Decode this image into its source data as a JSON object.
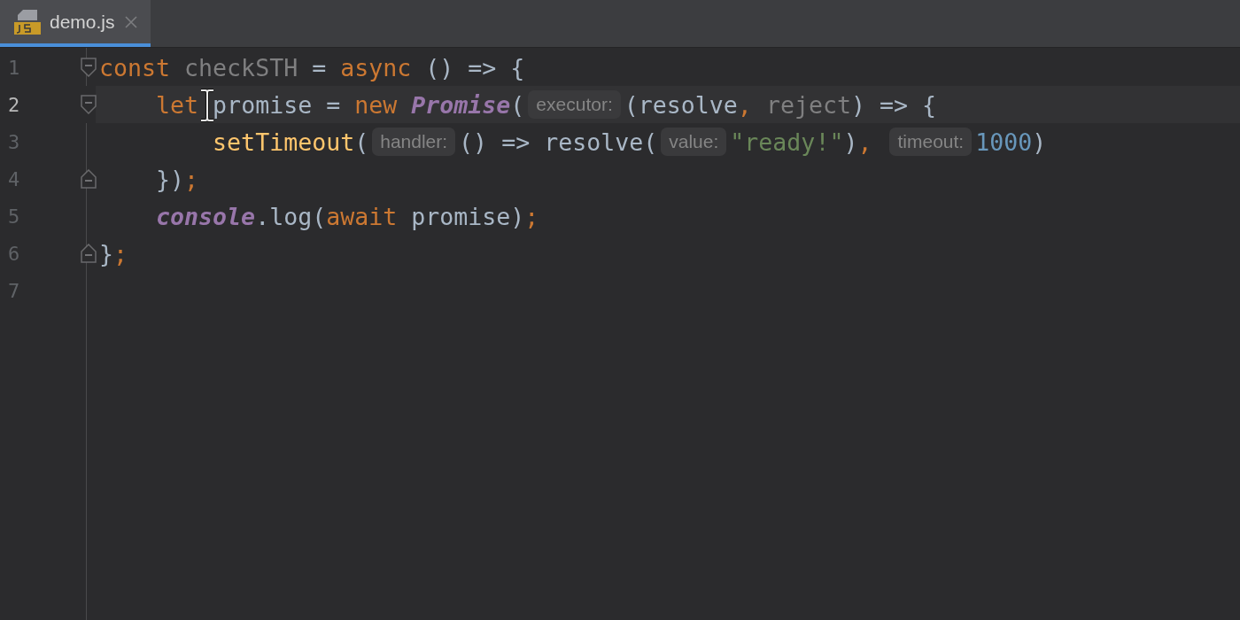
{
  "tabs": [
    {
      "label": "demo.js",
      "selected": true,
      "closable": true
    }
  ],
  "lines": [
    {
      "number": "1",
      "current": false,
      "fold_start": true,
      "fold_end": false,
      "tokens": [
        {
          "text": "const",
          "kind": "keyword"
        },
        {
          "text": " checkSTH",
          "kind": "unused"
        },
        {
          "text": " = ",
          "kind": "plain"
        },
        {
          "text": "async",
          "kind": "keyword"
        },
        {
          "text": " () => {",
          "kind": "plain"
        }
      ]
    },
    {
      "number": "2",
      "current": true,
      "fold_start": true,
      "fold_end": false,
      "tokens": [
        {
          "text": "    let",
          "kind": "keyword"
        },
        {
          "text": " promise = ",
          "kind": "plain"
        },
        {
          "text": "new ",
          "kind": "keyword"
        },
        {
          "text": "Promise",
          "kind": "class"
        },
        {
          "text": "(",
          "kind": "plain"
        },
        {
          "text": "executor:",
          "kind": "hint"
        },
        {
          "text": "(resolve",
          "kind": "plain"
        },
        {
          "text": ",",
          "kind": "comma"
        },
        {
          "text": " reject",
          "kind": "unused"
        },
        {
          "text": ") => {",
          "kind": "plain"
        }
      ]
    },
    {
      "number": "3",
      "current": false,
      "fold_start": false,
      "fold_end": false,
      "tokens": [
        {
          "text": "        setTimeout",
          "kind": "function"
        },
        {
          "text": "(",
          "kind": "plain"
        },
        {
          "text": "handler:",
          "kind": "hint"
        },
        {
          "text": "() => resolve(",
          "kind": "plain"
        },
        {
          "text": "value:",
          "kind": "hint"
        },
        {
          "text": "\"ready!\"",
          "kind": "string"
        },
        {
          "text": ")",
          "kind": "plain"
        },
        {
          "text": ", ",
          "kind": "comma"
        },
        {
          "text": "timeout:",
          "kind": "hint"
        },
        {
          "text": "1000",
          "kind": "number"
        },
        {
          "text": ")",
          "kind": "plain"
        }
      ]
    },
    {
      "number": "4",
      "current": false,
      "fold_start": false,
      "fold_end": true,
      "tokens": [
        {
          "text": "    })",
          "kind": "plain"
        },
        {
          "text": ";",
          "kind": "comma"
        }
      ]
    },
    {
      "number": "5",
      "current": false,
      "fold_start": false,
      "fold_end": false,
      "tokens": [
        {
          "text": "    console",
          "kind": "global"
        },
        {
          "text": ".log(",
          "kind": "plain"
        },
        {
          "text": "await",
          "kind": "keyword"
        },
        {
          "text": " promise)",
          "kind": "plain"
        },
        {
          "text": ";",
          "kind": "comma"
        }
      ]
    },
    {
      "number": "6",
      "current": false,
      "fold_start": false,
      "fold_end": true,
      "tokens": [
        {
          "text": "}",
          "kind": "plain"
        },
        {
          "text": ";",
          "kind": "comma"
        }
      ]
    },
    {
      "number": "7",
      "current": false,
      "fold_start": false,
      "fold_end": false
    }
  ]
}
